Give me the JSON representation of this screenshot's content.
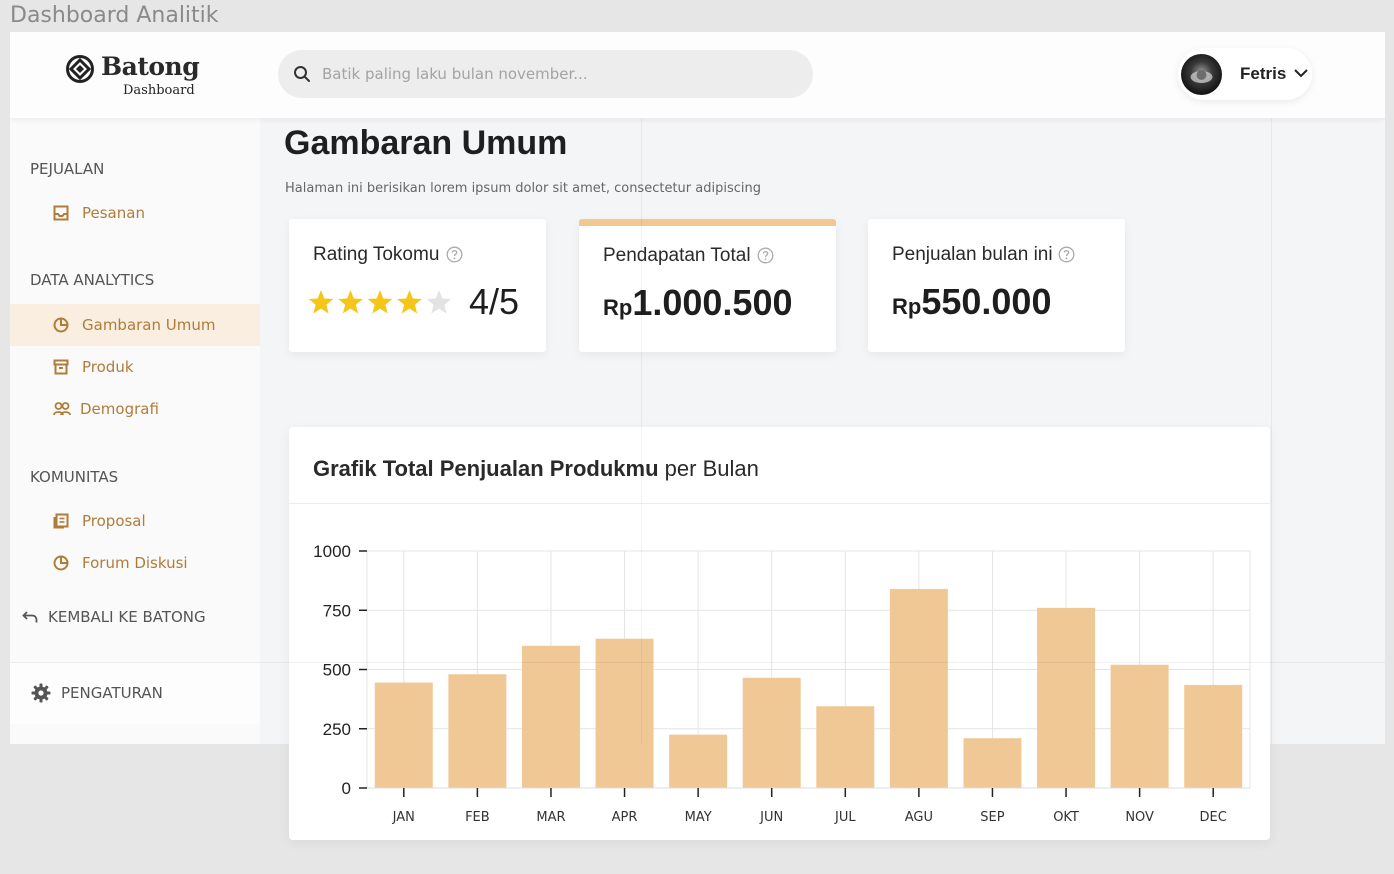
{
  "window": {
    "title": "Dashboard Analitik"
  },
  "header": {
    "brand": "Batong",
    "brand_sub": "Dashboard",
    "search_placeholder": "Batik paling laku bulan november...",
    "user_name": "Fetris"
  },
  "sidebar": {
    "sections": [
      {
        "title": "PEJUALAN",
        "items": [
          {
            "label": "Pesanan",
            "icon": "inbox-icon"
          }
        ]
      },
      {
        "title": "DATA ANALYTICS",
        "items": [
          {
            "label": "Gambaran Umum",
            "icon": "pie-chart-icon",
            "active": true
          },
          {
            "label": "Produk",
            "icon": "archive-icon"
          },
          {
            "label": "Demografi",
            "icon": "users-icon"
          }
        ]
      },
      {
        "title": "KOMUNITAS",
        "items": [
          {
            "label": "Proposal",
            "icon": "document-icon"
          },
          {
            "label": "Forum Diskusi",
            "icon": "pie-chart-icon"
          }
        ]
      }
    ],
    "back_label": "KEMBALI KE BATONG",
    "settings_label": "PENGATURAN"
  },
  "main": {
    "title": "Gambaran Umum",
    "description": "Halaman ini berisikan lorem ipsum dolor sit amet, consectetur adipiscing",
    "cards": [
      {
        "title": "Rating Tokomu",
        "value": "4/5",
        "stars": 4,
        "max_stars": 5
      },
      {
        "title": "Pendapatan Total",
        "currency": "Rp",
        "value": "1.000.500"
      },
      {
        "title": "Penjualan bulan ini",
        "currency": "Rp",
        "value": "550.000"
      }
    ],
    "chart_title_bold": "Grafik Total Penjualan Produkmu",
    "chart_title_rest": "per Bulan"
  },
  "colors": {
    "accent": "#f1c792",
    "bar": "#f0c896",
    "nav_text": "#b07c3a",
    "active_bg": "#faeee0",
    "star": "#f5c518"
  },
  "chart_data": {
    "type": "bar",
    "categories": [
      "JAN",
      "FEB",
      "MAR",
      "APR",
      "MAY",
      "JUN",
      "JUL",
      "AGU",
      "SEP",
      "OKT",
      "NOV",
      "DEC"
    ],
    "values": [
      445,
      480,
      600,
      630,
      225,
      465,
      345,
      840,
      210,
      760,
      520,
      435
    ],
    "yticks": [
      "0",
      "250",
      "500",
      "750",
      "1000"
    ],
    "ylim": [
      0,
      1000
    ],
    "grid": true
  }
}
